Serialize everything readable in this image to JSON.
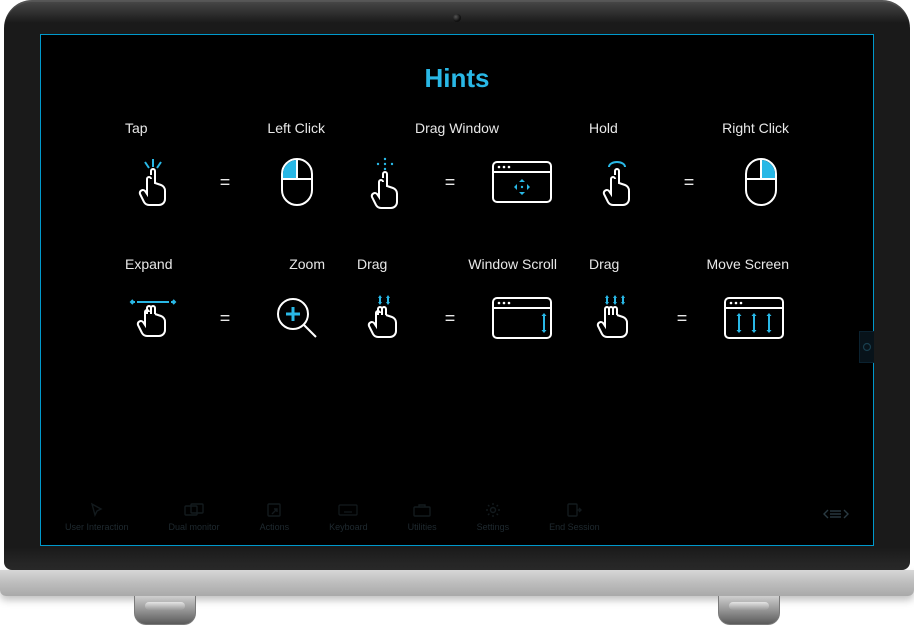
{
  "title": "Hints",
  "accent": "#29b8e6",
  "hints": [
    [
      {
        "gesture": "Tap",
        "result": "Left Click",
        "gestureIcon": "tap",
        "resultIcon": "mouse-left"
      },
      {
        "gesture": "",
        "result": "Drag Window",
        "gestureIcon": "drag-finger",
        "resultIcon": "window-move",
        "centered": true
      },
      {
        "gesture": "Hold",
        "result": "Right Click",
        "gestureIcon": "hold",
        "resultIcon": "mouse-right"
      }
    ],
    [
      {
        "gesture": "Expand",
        "result": "Zoom",
        "gestureIcon": "pinch",
        "resultIcon": "zoom"
      },
      {
        "gesture": "Drag",
        "result": "Window Scroll",
        "gestureIcon": "two-finger-vert",
        "resultIcon": "window-scroll"
      },
      {
        "gesture": "Drag",
        "result": "Move Screen",
        "gestureIcon": "three-finger-vert",
        "resultIcon": "window-pan"
      }
    ]
  ],
  "toolbar": {
    "items": [
      {
        "label": "User Interaction",
        "icon": "cursor"
      },
      {
        "label": "Dual monitor",
        "icon": "monitors"
      },
      {
        "label": "Actions",
        "icon": "actions"
      },
      {
        "label": "Keyboard",
        "icon": "keyboard"
      },
      {
        "label": "Utilities",
        "icon": "briefcase"
      },
      {
        "label": "Settings",
        "icon": "gear"
      },
      {
        "label": "End Session",
        "icon": "exit"
      }
    ]
  }
}
